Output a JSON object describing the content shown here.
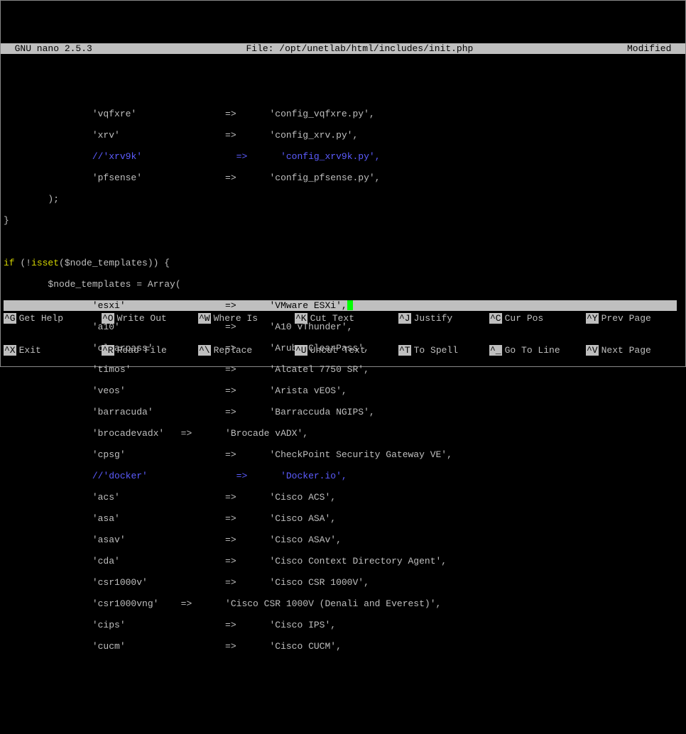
{
  "header": {
    "app": "  GNU nano 2.5.3",
    "file": "File: /opt/unetlab/html/includes/init.php",
    "status": "Modified  "
  },
  "code": {
    "l01a": "                'vqfxre'                =>      'config_vqfxre.py',",
    "l01b": "                'xrv'                   =>      'config_xrv.py',",
    "l02a": "                //",
    "l02b": "'xrv9k'                 =>      'config_xrv9k.py',",
    "l03": "                'pfsense'               =>      'config_pfsense.py',",
    "l04": "        );",
    "l05": "}",
    "l06": "",
    "l07a": "if",
    "l07b": " (!",
    "l07c": "isset",
    "l07d": "($node_templates)) {",
    "l08": "        $node_templates = Array(",
    "l09": "                'esxi'                  =>      'VMware ESXi',",
    "l10": "                'a10'                   =>      'A10 vThunder',",
    "l11": "                'clearpass'             =>      'Aruba ClearPass',",
    "l12": "                'timos'                 =>      'Alcatel 7750 SR',",
    "l13": "                'veos'                  =>      'Arista vEOS',",
    "l14": "                'barracuda'             =>      'Barraccuda NGIPS',",
    "l15": "                'brocadevadx'   =>      'Brocade vADX',",
    "l16": "                'cpsg'                  =>      'CheckPoint Security Gateway VE',",
    "l17a": "                //",
    "l17b": "'docker'                =>      'Docker.io',",
    "l18": "                'acs'                   =>      'Cisco ACS',",
    "l19": "                'asa'                   =>      'Cisco ASA',",
    "l20": "                'asav'                  =>      'Cisco ASAv',",
    "l21": "                'cda'                   =>      'Cisco Context Directory Agent',",
    "l22": "                'csr1000v'              =>      'Cisco CSR 1000V',",
    "l23": "                'csr1000vng'    =>      'Cisco CSR 1000V (Denali and Everest)',",
    "l24": "                'cips'                  =>      'Cisco IPS',",
    "l25": "                'cucm'                  =>      'Cisco CUCM',"
  },
  "footer": {
    "row1": [
      {
        "key": "^G",
        "label": "Get Help"
      },
      {
        "key": "^O",
        "label": "Write Out"
      },
      {
        "key": "^W",
        "label": "Where Is"
      },
      {
        "key": "^K",
        "label": "Cut Text"
      },
      {
        "key": "^J",
        "label": "Justify"
      },
      {
        "key": "^C",
        "label": "Cur Pos"
      },
      {
        "key": "^Y",
        "label": "Prev Page"
      }
    ],
    "row2": [
      {
        "key": "^X",
        "label": "Exit"
      },
      {
        "key": "^R",
        "label": "Read File"
      },
      {
        "key": "^\\",
        "label": "Replace"
      },
      {
        "key": "^U",
        "label": "Uncut Text"
      },
      {
        "key": "^T",
        "label": "To Spell"
      },
      {
        "key": "^_",
        "label": "Go To Line"
      },
      {
        "key": "^V",
        "label": "Next Page"
      }
    ]
  }
}
